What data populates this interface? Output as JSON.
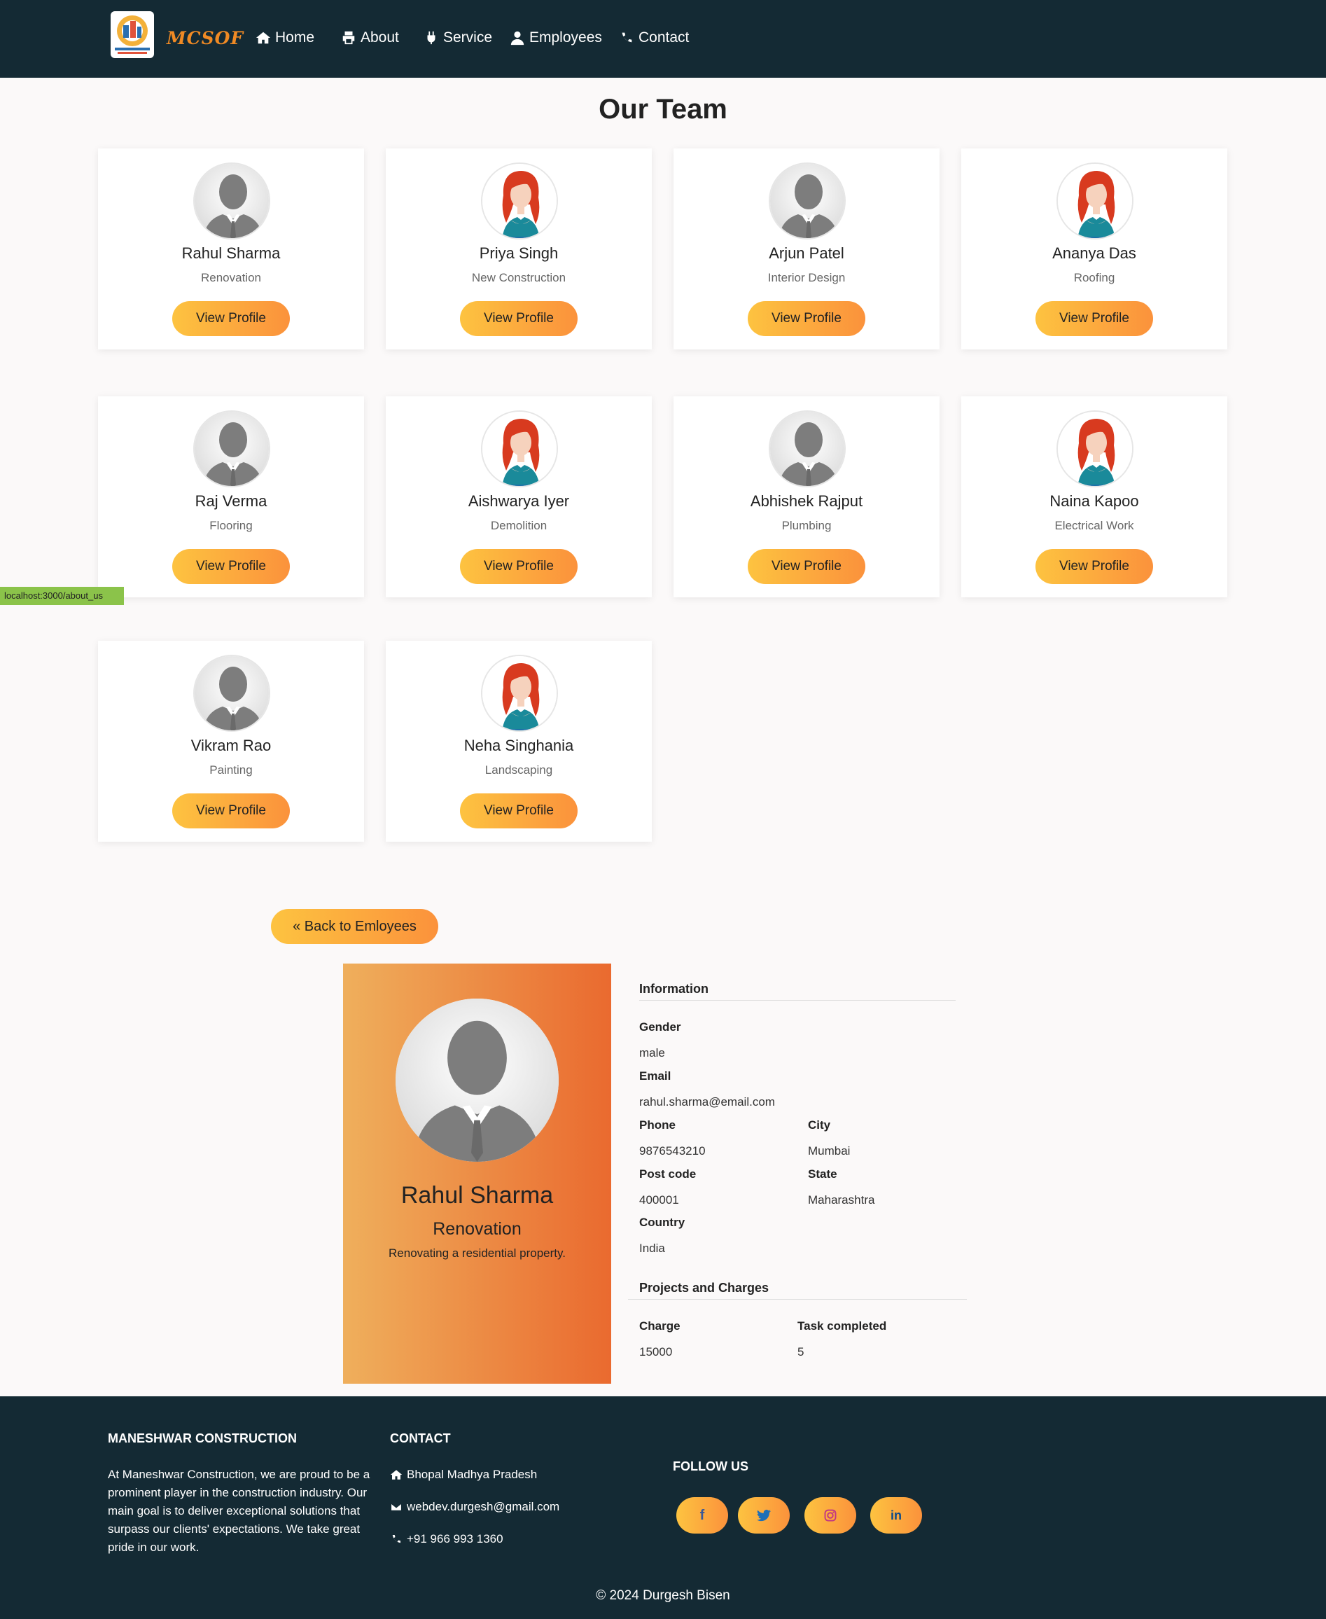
{
  "nav": {
    "brand": "MCSOF",
    "items": [
      {
        "label": "Home",
        "icon": "home-icon"
      },
      {
        "label": "About",
        "icon": "printer-icon"
      },
      {
        "label": "Service",
        "icon": "plug-icon"
      },
      {
        "label": "Employees",
        "icon": "user-icon"
      },
      {
        "label": "Contact",
        "icon": "phone-icon"
      }
    ]
  },
  "team": {
    "title": "Our Team",
    "button_label": "View Profile",
    "members": [
      {
        "name": "Rahul Sharma",
        "role": "Renovation",
        "gender": "male"
      },
      {
        "name": "Priya Singh",
        "role": "New Construction",
        "gender": "female"
      },
      {
        "name": "Arjun Patel",
        "role": "Interior Design",
        "gender": "male"
      },
      {
        "name": "Ananya Das",
        "role": "Roofing",
        "gender": "female"
      },
      {
        "name": "Raj Verma",
        "role": "Flooring",
        "gender": "male"
      },
      {
        "name": "Aishwarya Iyer",
        "role": "Demolition",
        "gender": "female"
      },
      {
        "name": "Abhishek Rajput",
        "role": "Plumbing",
        "gender": "male"
      },
      {
        "name": "Naina Kapoo",
        "role": "Electrical Work",
        "gender": "female"
      },
      {
        "name": "Vikram Rao",
        "role": "Painting",
        "gender": "male"
      },
      {
        "name": "Neha Singhania",
        "role": "Landscaping",
        "gender": "female"
      }
    ]
  },
  "status_url": "localhost:3000/about_us",
  "back_button": "« Back to Emloyees",
  "profile": {
    "name": "Rahul Sharma",
    "role": "Renovation",
    "description": "Renovating a residential property.",
    "info_heading": "Information",
    "gender_label": "Gender",
    "gender": "male",
    "email_label": "Email",
    "email": "rahul.sharma@email.com",
    "phone_label": "Phone",
    "phone": "9876543210",
    "city_label": "City",
    "city": "Mumbai",
    "postcode_label": "Post code",
    "postcode": "400001",
    "state_label": "State",
    "state": "Maharashtra",
    "country_label": "Country",
    "country": "India",
    "projects_heading": "Projects and Charges",
    "charge_label": "Charge",
    "charge": "15000",
    "tasks_label": "Task completed",
    "tasks": "5"
  },
  "footer": {
    "company_heading": "MANESHWAR CONSTRUCTION",
    "company_text": "At Maneshwar Construction, we are proud to be a prominent player in the construction industry. Our main goal is to deliver exceptional solutions that surpass our clients' expectations. We take great pride in our work.",
    "contact_heading": "CONTACT",
    "address": "Bhopal Madhya Pradesh",
    "email": "webdev.durgesh@gmail.com",
    "phone": "+91 966 993 1360",
    "follow_heading": "FOLLOW US",
    "social": [
      "facebook-icon",
      "twitter-icon",
      "instagram-icon",
      "linkedin-icon"
    ],
    "copyright": "© 2024 Durgesh Bisen"
  },
  "colors": {
    "nav_bg": "#142a34",
    "accent_start": "#fdc340",
    "accent_end": "#fb923c",
    "brand": "#f08a24",
    "facebook": "#3b5998",
    "twitter": "#1d6fb8",
    "instagram": "#c13584",
    "linkedin": "#0a4a8a"
  }
}
